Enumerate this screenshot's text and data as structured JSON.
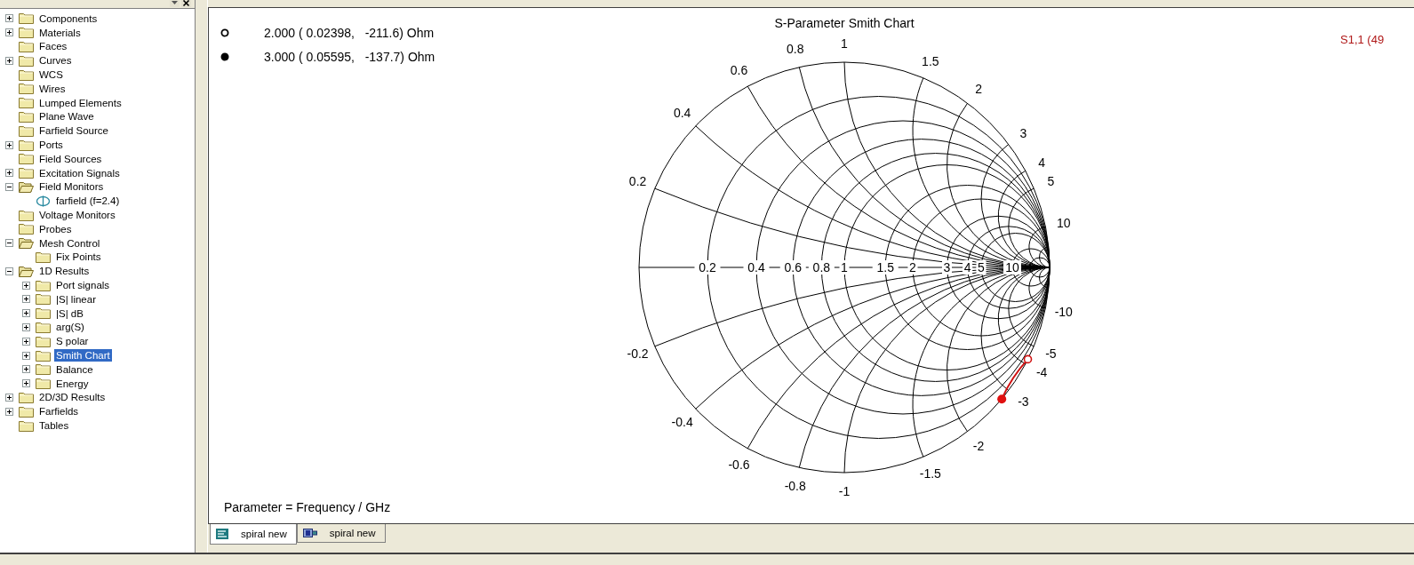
{
  "tree_panel": {
    "items": [
      {
        "label": "Components",
        "kind": "folder",
        "expanded": false,
        "selected": false
      },
      {
        "label": "Materials",
        "kind": "folder",
        "expanded": false,
        "selected": false
      },
      {
        "label": "Faces",
        "kind": "folder",
        "selected": false
      },
      {
        "label": "Curves",
        "kind": "folder",
        "expanded": false,
        "selected": false
      },
      {
        "label": "WCS",
        "kind": "folder",
        "selected": false
      },
      {
        "label": "Wires",
        "kind": "folder",
        "selected": false
      },
      {
        "label": "Lumped Elements",
        "kind": "folder",
        "selected": false
      },
      {
        "label": "Plane Wave",
        "kind": "folder",
        "selected": false
      },
      {
        "label": "Farfield Source",
        "kind": "folder",
        "selected": false
      },
      {
        "label": "Ports",
        "kind": "folder",
        "expanded": false,
        "selected": false
      },
      {
        "label": "Field Sources",
        "kind": "folder",
        "selected": false
      },
      {
        "label": "Excitation Signals",
        "kind": "folder",
        "expanded": false,
        "selected": false
      },
      {
        "label": "Field Monitors",
        "kind": "folder",
        "expanded": true,
        "selected": false,
        "children": [
          {
            "label": "farfield (f=2.4)",
            "kind": "monitor",
            "selected": false
          }
        ]
      },
      {
        "label": "Voltage Monitors",
        "kind": "folder",
        "selected": false
      },
      {
        "label": "Probes",
        "kind": "folder",
        "selected": false
      },
      {
        "label": "Mesh Control",
        "kind": "folder",
        "expanded": true,
        "selected": false,
        "children": [
          {
            "label": "Fix Points",
            "kind": "folder",
            "selected": false
          }
        ]
      },
      {
        "label": "1D Results",
        "kind": "folder",
        "expanded": true,
        "selected": false,
        "children": [
          {
            "label": "Port signals",
            "kind": "folder",
            "expanded": false,
            "selected": false
          },
          {
            "label": "|S| linear",
            "kind": "folder",
            "expanded": false,
            "selected": false
          },
          {
            "label": "|S| dB",
            "kind": "folder",
            "expanded": false,
            "selected": false
          },
          {
            "label": "arg(S)",
            "kind": "folder",
            "expanded": false,
            "selected": false
          },
          {
            "label": "S polar",
            "kind": "folder",
            "expanded": false,
            "selected": false
          },
          {
            "label": "Smith Chart",
            "kind": "folder",
            "expanded": false,
            "selected": true
          },
          {
            "label": "Balance",
            "kind": "folder",
            "expanded": false,
            "selected": false
          },
          {
            "label": "Energy",
            "kind": "folder",
            "expanded": false,
            "selected": false
          }
        ]
      },
      {
        "label": "2D/3D Results",
        "kind": "folder",
        "expanded": false,
        "selected": false
      },
      {
        "label": "Farfields",
        "kind": "folder",
        "expanded": false,
        "selected": false
      },
      {
        "label": "Tables",
        "kind": "folder",
        "selected": false
      }
    ]
  },
  "plot": {
    "title": "S-Parameter Smith Chart",
    "legend": [
      {
        "kind": "open",
        "text": "2.000 ( 0.02398,   -211.6) Ohm"
      },
      {
        "kind": "filled",
        "text": "3.000 ( 0.05595,   -137.7) Ohm"
      }
    ],
    "trace_label": "S1,1 (49",
    "real_axis_labels": [
      "0.2",
      "0.4",
      "0.6",
      "0.8",
      "1",
      "1.5",
      "2",
      "3",
      "4",
      "5",
      "10"
    ],
    "positive_reactance_labels": [
      "0.2",
      "0.4",
      "0.6",
      "0.8",
      "1",
      "1.5",
      "2",
      "3",
      "4",
      "5",
      "10"
    ],
    "negative_reactance_labels": [
      "-0.2",
      "-0.4",
      "-0.6",
      "-0.8",
      "-1",
      "-1.5",
      "-2",
      "-3",
      "-4",
      "-5",
      "-10"
    ],
    "footer": "Parameter = Frequency / GHz"
  },
  "tabs": [
    {
      "label": "spiral new",
      "kind": "chart",
      "selected": true
    },
    {
      "label": "spiral new",
      "kind": "model",
      "selected": false
    }
  ]
}
